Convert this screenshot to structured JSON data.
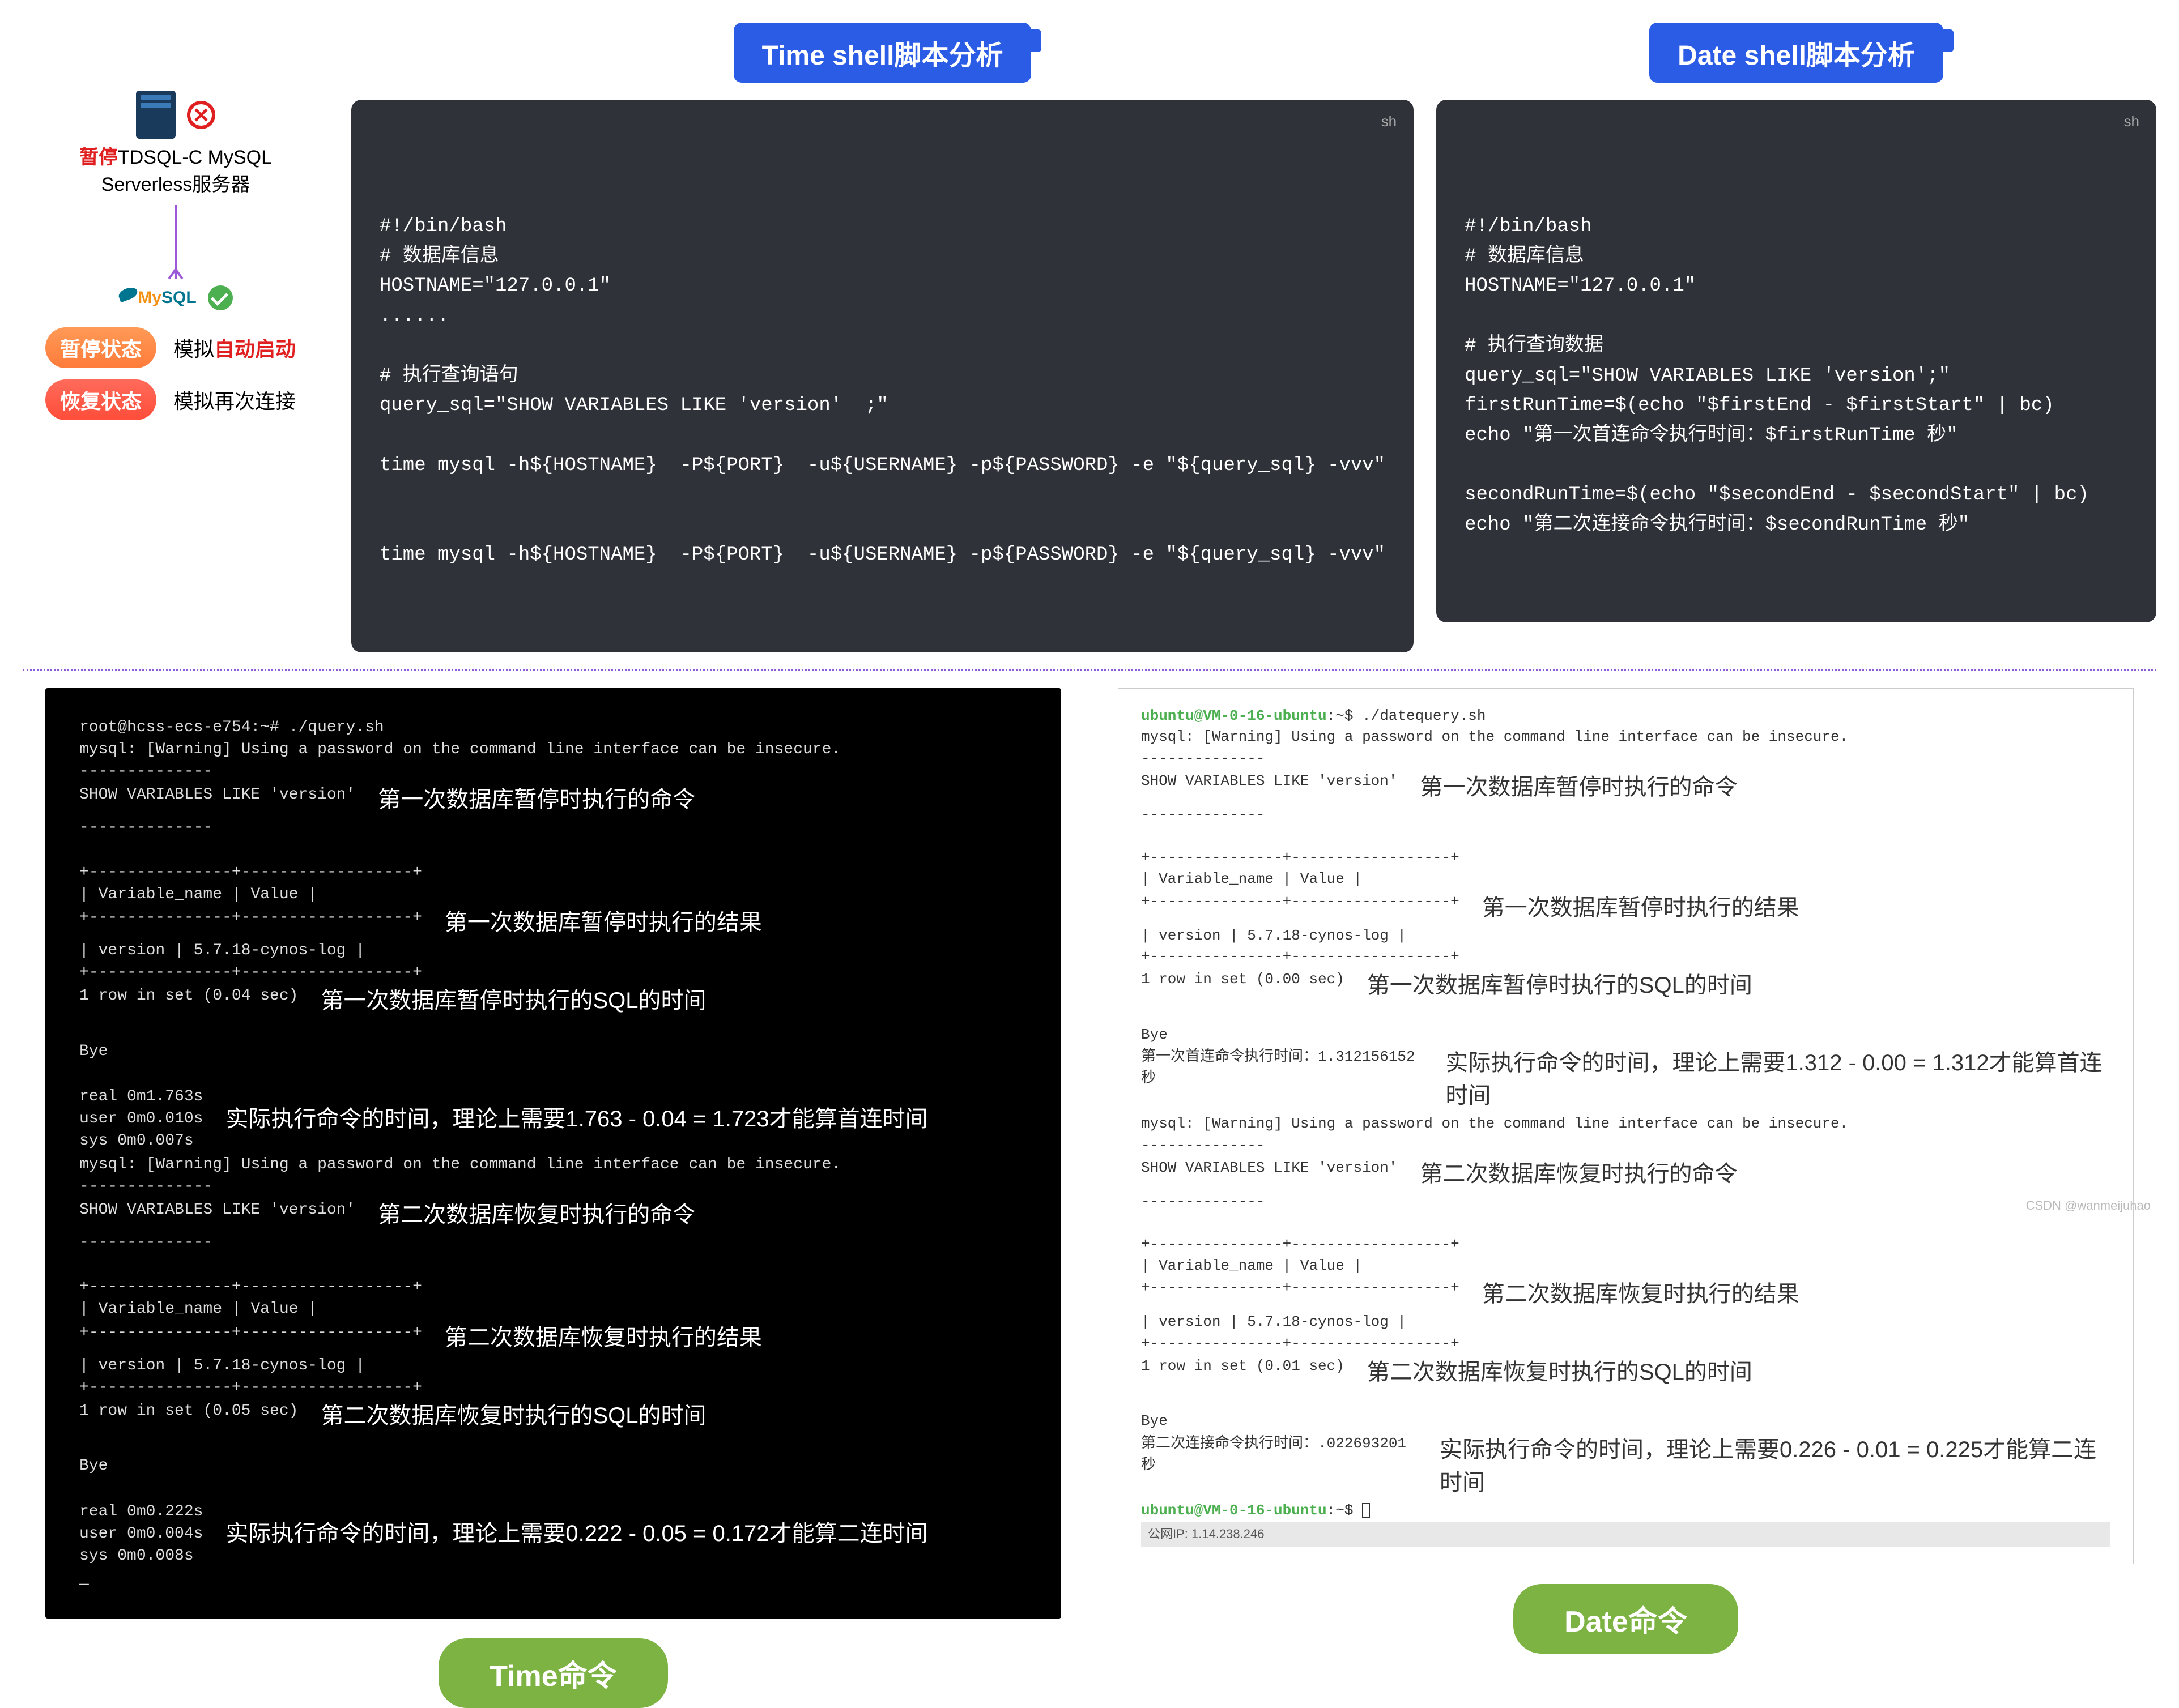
{
  "titles": {
    "time_shell": "Time shell脚本分析",
    "date_shell": "Date shell脚本分析"
  },
  "left_panel": {
    "caption_html_pause": "暂停",
    "caption_rest": "TDSQL-C MySQL\nServerless服务器",
    "auto_start_prefix": "模拟",
    "auto_start_em": "自动启动",
    "reconnect": "模拟再次连接",
    "state_pause": "暂停状态",
    "state_resume": "恢复状态"
  },
  "code_time": "#!/bin/bash\n# 数据库信息\nHOSTNAME=\"127.0.0.1\"\n......\n\n# 执行查询语句\nquery_sql=\"SHOW VARIABLES LIKE 'version'  ;\"\n\ntime mysql -h${HOSTNAME}  -P${PORT}  -u${USERNAME} -p${PASSWORD} -e \"${query_sql} -vvv\"\n\n\ntime mysql -h${HOSTNAME}  -P${PORT}  -u${USERNAME} -p${PASSWORD} -e \"${query_sql} -vvv\"",
  "code_date": "#!/bin/bash\n# 数据库信息\nHOSTNAME=\"127.0.0.1\"\n\n# 执行查询数据\nquery_sql=\"SHOW VARIABLES LIKE 'version';\"\nfirstRunTime=$(echo \"$firstEnd - $firstStart\" | bc)\necho \"第一次首连命令执行时间：$firstRunTime 秒\"\n\nsecondRunTime=$(echo \"$secondEnd - $secondStart\" | bc)\necho \"第二次连接命令执行时间：$secondRunTime 秒\"",
  "lang_label": "sh",
  "term_dark": {
    "l0": "root@hcss-ecs-e754:~# ./query.sh",
    "l1": "mysql: [Warning] Using a password on the command line interface can be insecure.",
    "l2": "--------------",
    "l3": "SHOW VARIABLES LIKE 'version'",
    "ann1": "第一次数据库暂停时执行的命令",
    "l4": "--------------",
    "l5": "+---------------+------------------+",
    "l6": "| Variable_name | Value            |",
    "l7": "+---------------+------------------+",
    "ann2": "第一次数据库暂停时执行的结果",
    "l8": "| version       | 5.7.18-cynos-log |",
    "l9": "+---------------+------------------+",
    "l10": "1 row in set (0.04 sec)",
    "ann3": "第一次数据库暂停时执行的SQL的时间",
    "l11": "Bye",
    "l12": "real    0m1.763s",
    "l13": "user    0m0.010s",
    "l14": "sys     0m0.007s",
    "ann4": "实际执行命令的时间，理论上需要1.763 - 0.04 = 1.723才能算首连时间",
    "l15": "mysql: [Warning] Using a password on the command line interface can be insecure.",
    "l16": "--------------",
    "l17": "SHOW VARIABLES LIKE 'version'",
    "ann5": "第二次数据库恢复时执行的命令",
    "l18": "--------------",
    "l19": "+---------------+------------------+",
    "l20": "| Variable_name | Value            |",
    "l21": "+---------------+------------------+",
    "ann6": "第二次数据库恢复时执行的结果",
    "l22": "| version       | 5.7.18-cynos-log |",
    "l23": "+---------------+------------------+",
    "l24": "1 row in set (0.05 sec)",
    "ann7": "第二次数据库恢复时执行的SQL的时间",
    "l25": "Bye",
    "l26": "real    0m0.222s",
    "l27": "user    0m0.004s",
    "l28": "sys     0m0.008s",
    "ann8": "实际执行命令的时间，理论上需要0.222 - 0.05 = 0.172才能算二连时间",
    "l29": "_"
  },
  "term_light": {
    "p0_user": "ubuntu@VM-0-16-ubuntu",
    "p0_cmd": ":~$ ./datequery.sh",
    "l1": "mysql: [Warning] Using a password on the command line interface can be insecure.",
    "l2": "--------------",
    "l3": "SHOW VARIABLES LIKE 'version'",
    "ann1": "第一次数据库暂停时执行的命令",
    "l4": "--------------",
    "l5": "+---------------+------------------+",
    "l6": "| Variable_name | Value            |",
    "l7": "+---------------+------------------+",
    "ann2": "第一次数据库暂停时执行的结果",
    "l8": "| version       | 5.7.18-cynos-log |",
    "l9": "+---------------+------------------+",
    "l10": "1 row in set (0.00 sec)",
    "ann3": "第一次数据库暂停时执行的SQL的时间",
    "l11": "Bye",
    "l12": "第一次首连命令执行时间：1.312156152 秒",
    "ann4": "实际执行命令的时间，理论上需要1.312 - 0.00 = 1.312才能算首连时间",
    "l13": "mysql: [Warning] Using a password on the command line interface can be insecure.",
    "l14": "--------------",
    "l15": "SHOW VARIABLES LIKE 'version'",
    "ann5": "第二次数据库恢复时执行的命令",
    "l16": "--------------",
    "l17": "+---------------+------------------+",
    "l18": "| Variable_name | Value            |",
    "l19": "+---------------+------------------+",
    "ann6": "第二次数据库恢复时执行的结果",
    "l20": "| version       | 5.7.18-cynos-log |",
    "l21": "+---------------+------------------+",
    "l22": "1 row in set (0.01 sec)",
    "ann7": "第二次数据库恢复时执行的SQL的时间",
    "l23": "Bye",
    "l24": "第二次连接命令执行时间：.022693201 秒",
    "ann8": "实际执行命令的时间，理论上需要0.226 - 0.01 = 0.225才能算二连时间",
    "p1_user": "ubuntu@VM-0-16-ubuntu",
    "p1_cmd": ":~$ ",
    "status": "公网IP: 1.14.238.246"
  },
  "big_pills": {
    "time": "Time命令",
    "date": "Date命令"
  },
  "watermark": "CSDN @wanmeijuhao"
}
